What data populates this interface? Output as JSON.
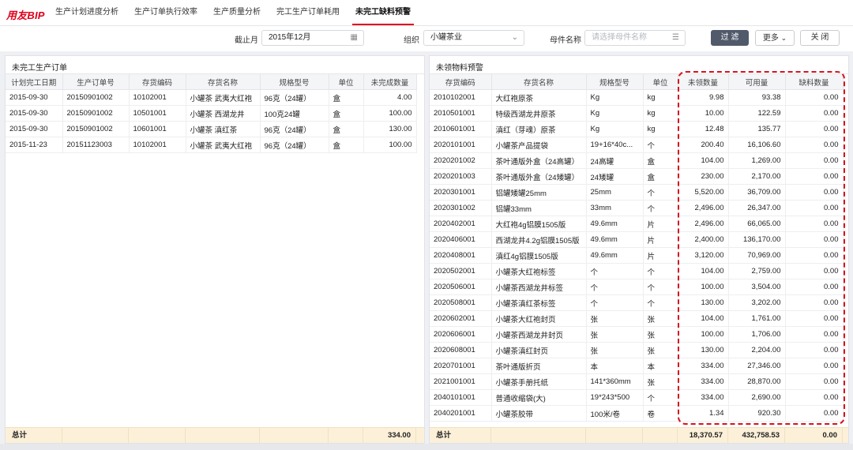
{
  "app": {
    "logo": "用友BIP"
  },
  "tabs": [
    "生产计划进度分析",
    "生产订单执行效率",
    "生产质量分析",
    "完工生产订单耗用",
    "未完工缺料预警"
  ],
  "active_tab": 4,
  "filters": {
    "deadline_label": "截止月",
    "deadline_value": "2015年12月",
    "org_label": "组织",
    "org_value": "小罐茶业",
    "parent_label": "母件名称",
    "parent_placeholder": "请选择母件名称"
  },
  "buttons": {
    "filter": "过 滤",
    "more": "更多",
    "close": "关 闭"
  },
  "left_panel": {
    "title": "未完工生产订单",
    "columns": [
      "计划完工日期",
      "生产订单号",
      "存货编码",
      "存货名称",
      "规格型号",
      "单位",
      "未完成数量"
    ],
    "rows": [
      [
        "2015-09-30",
        "20150901002",
        "10102001",
        "小罐茶 武夷大红袍",
        "96克（24罐）",
        "盒",
        "4.00"
      ],
      [
        "2015-09-30",
        "20150901002",
        "10501001",
        "小罐茶 西湖龙井",
        "100克24罐",
        "盒",
        "100.00"
      ],
      [
        "2015-09-30",
        "20150901002",
        "10601001",
        "小罐茶 滇红茶",
        "96克（24罐）",
        "盒",
        "130.00"
      ],
      [
        "2015-11-23",
        "20151123003",
        "10102001",
        "小罐茶 武夷大红袍",
        "96克（24罐）",
        "盒",
        "100.00"
      ]
    ],
    "total_label": "总计",
    "total_value": "334.00"
  },
  "right_panel": {
    "title": "未领物料预警",
    "columns": [
      "存货编码",
      "存货名称",
      "规格型号",
      "单位",
      "未领数量",
      "可用量",
      "缺料数量"
    ],
    "rows": [
      [
        "2010102001",
        "大红袍原茶",
        "Kg",
        "kg",
        "9.98",
        "93.38",
        "0.00"
      ],
      [
        "2010501001",
        "特级西湖龙井原茶",
        "Kg",
        "kg",
        "10.00",
        "122.59",
        "0.00"
      ],
      [
        "2010601001",
        "滇红（芽魂）原茶",
        "Kg",
        "kg",
        "12.48",
        "135.77",
        "0.00"
      ],
      [
        "2020101001",
        "小罐茶产品提袋",
        "19+16*40c...",
        "个",
        "200.40",
        "16,106.60",
        "0.00"
      ],
      [
        "2020201002",
        "茶叶通版外盒（24高罐）",
        "24高罐",
        "盒",
        "104.00",
        "1,269.00",
        "0.00"
      ],
      [
        "2020201003",
        "茶叶通版外盒（24矮罐）",
        "24矮罐",
        "盒",
        "230.00",
        "2,170.00",
        "0.00"
      ],
      [
        "2020301001",
        "铝罐矮罐25mm",
        "25mm",
        "个",
        "5,520.00",
        "36,709.00",
        "0.00"
      ],
      [
        "2020301002",
        "铝罐33mm",
        "33mm",
        "个",
        "2,496.00",
        "26,347.00",
        "0.00"
      ],
      [
        "2020402001",
        "大红袍4g铝膜1505版",
        "49.6mm",
        "片",
        "2,496.00",
        "66,065.00",
        "0.00"
      ],
      [
        "2020406001",
        "西湖龙井4.2g铝膜1505版",
        "49.6mm",
        "片",
        "2,400.00",
        "136,170.00",
        "0.00"
      ],
      [
        "2020408001",
        "滇红4g铝膜1505版",
        "49.6mm",
        "片",
        "3,120.00",
        "70,969.00",
        "0.00"
      ],
      [
        "2020502001",
        "小罐茶大红袍标签",
        "个",
        "个",
        "104.00",
        "2,759.00",
        "0.00"
      ],
      [
        "2020506001",
        "小罐茶西湖龙井标签",
        "个",
        "个",
        "100.00",
        "3,504.00",
        "0.00"
      ],
      [
        "2020508001",
        "小罐茶滇红茶标签",
        "个",
        "个",
        "130.00",
        "3,202.00",
        "0.00"
      ],
      [
        "2020602001",
        "小罐茶大红袍封页",
        "张",
        "张",
        "104.00",
        "1,761.00",
        "0.00"
      ],
      [
        "2020606001",
        "小罐茶西湖龙井封页",
        "张",
        "张",
        "100.00",
        "1,706.00",
        "0.00"
      ],
      [
        "2020608001",
        "小罐茶滇红封页",
        "张",
        "张",
        "130.00",
        "2,204.00",
        "0.00"
      ],
      [
        "2020701001",
        "茶叶通版折页",
        "本",
        "本",
        "334.00",
        "27,346.00",
        "0.00"
      ],
      [
        "2021001001",
        "小罐茶手册托纸",
        "141*360mm",
        "张",
        "334.00",
        "28,870.00",
        "0.00"
      ],
      [
        "2040101001",
        "普通收缩袋(大)",
        "19*243*500",
        "个",
        "334.00",
        "2,690.00",
        "0.00"
      ],
      [
        "2040201001",
        "小罐茶胶带",
        "100米/卷",
        "卷",
        "1.34",
        "920.30",
        "0.00"
      ]
    ],
    "total_label": "总计",
    "total_unclaimed": "18,370.57",
    "total_available": "432,758.53",
    "total_shortage": "0.00"
  },
  "colors": {
    "brand": "#e0001b",
    "highlight": "#d6121e",
    "total_bg": "#fcf0d8"
  }
}
